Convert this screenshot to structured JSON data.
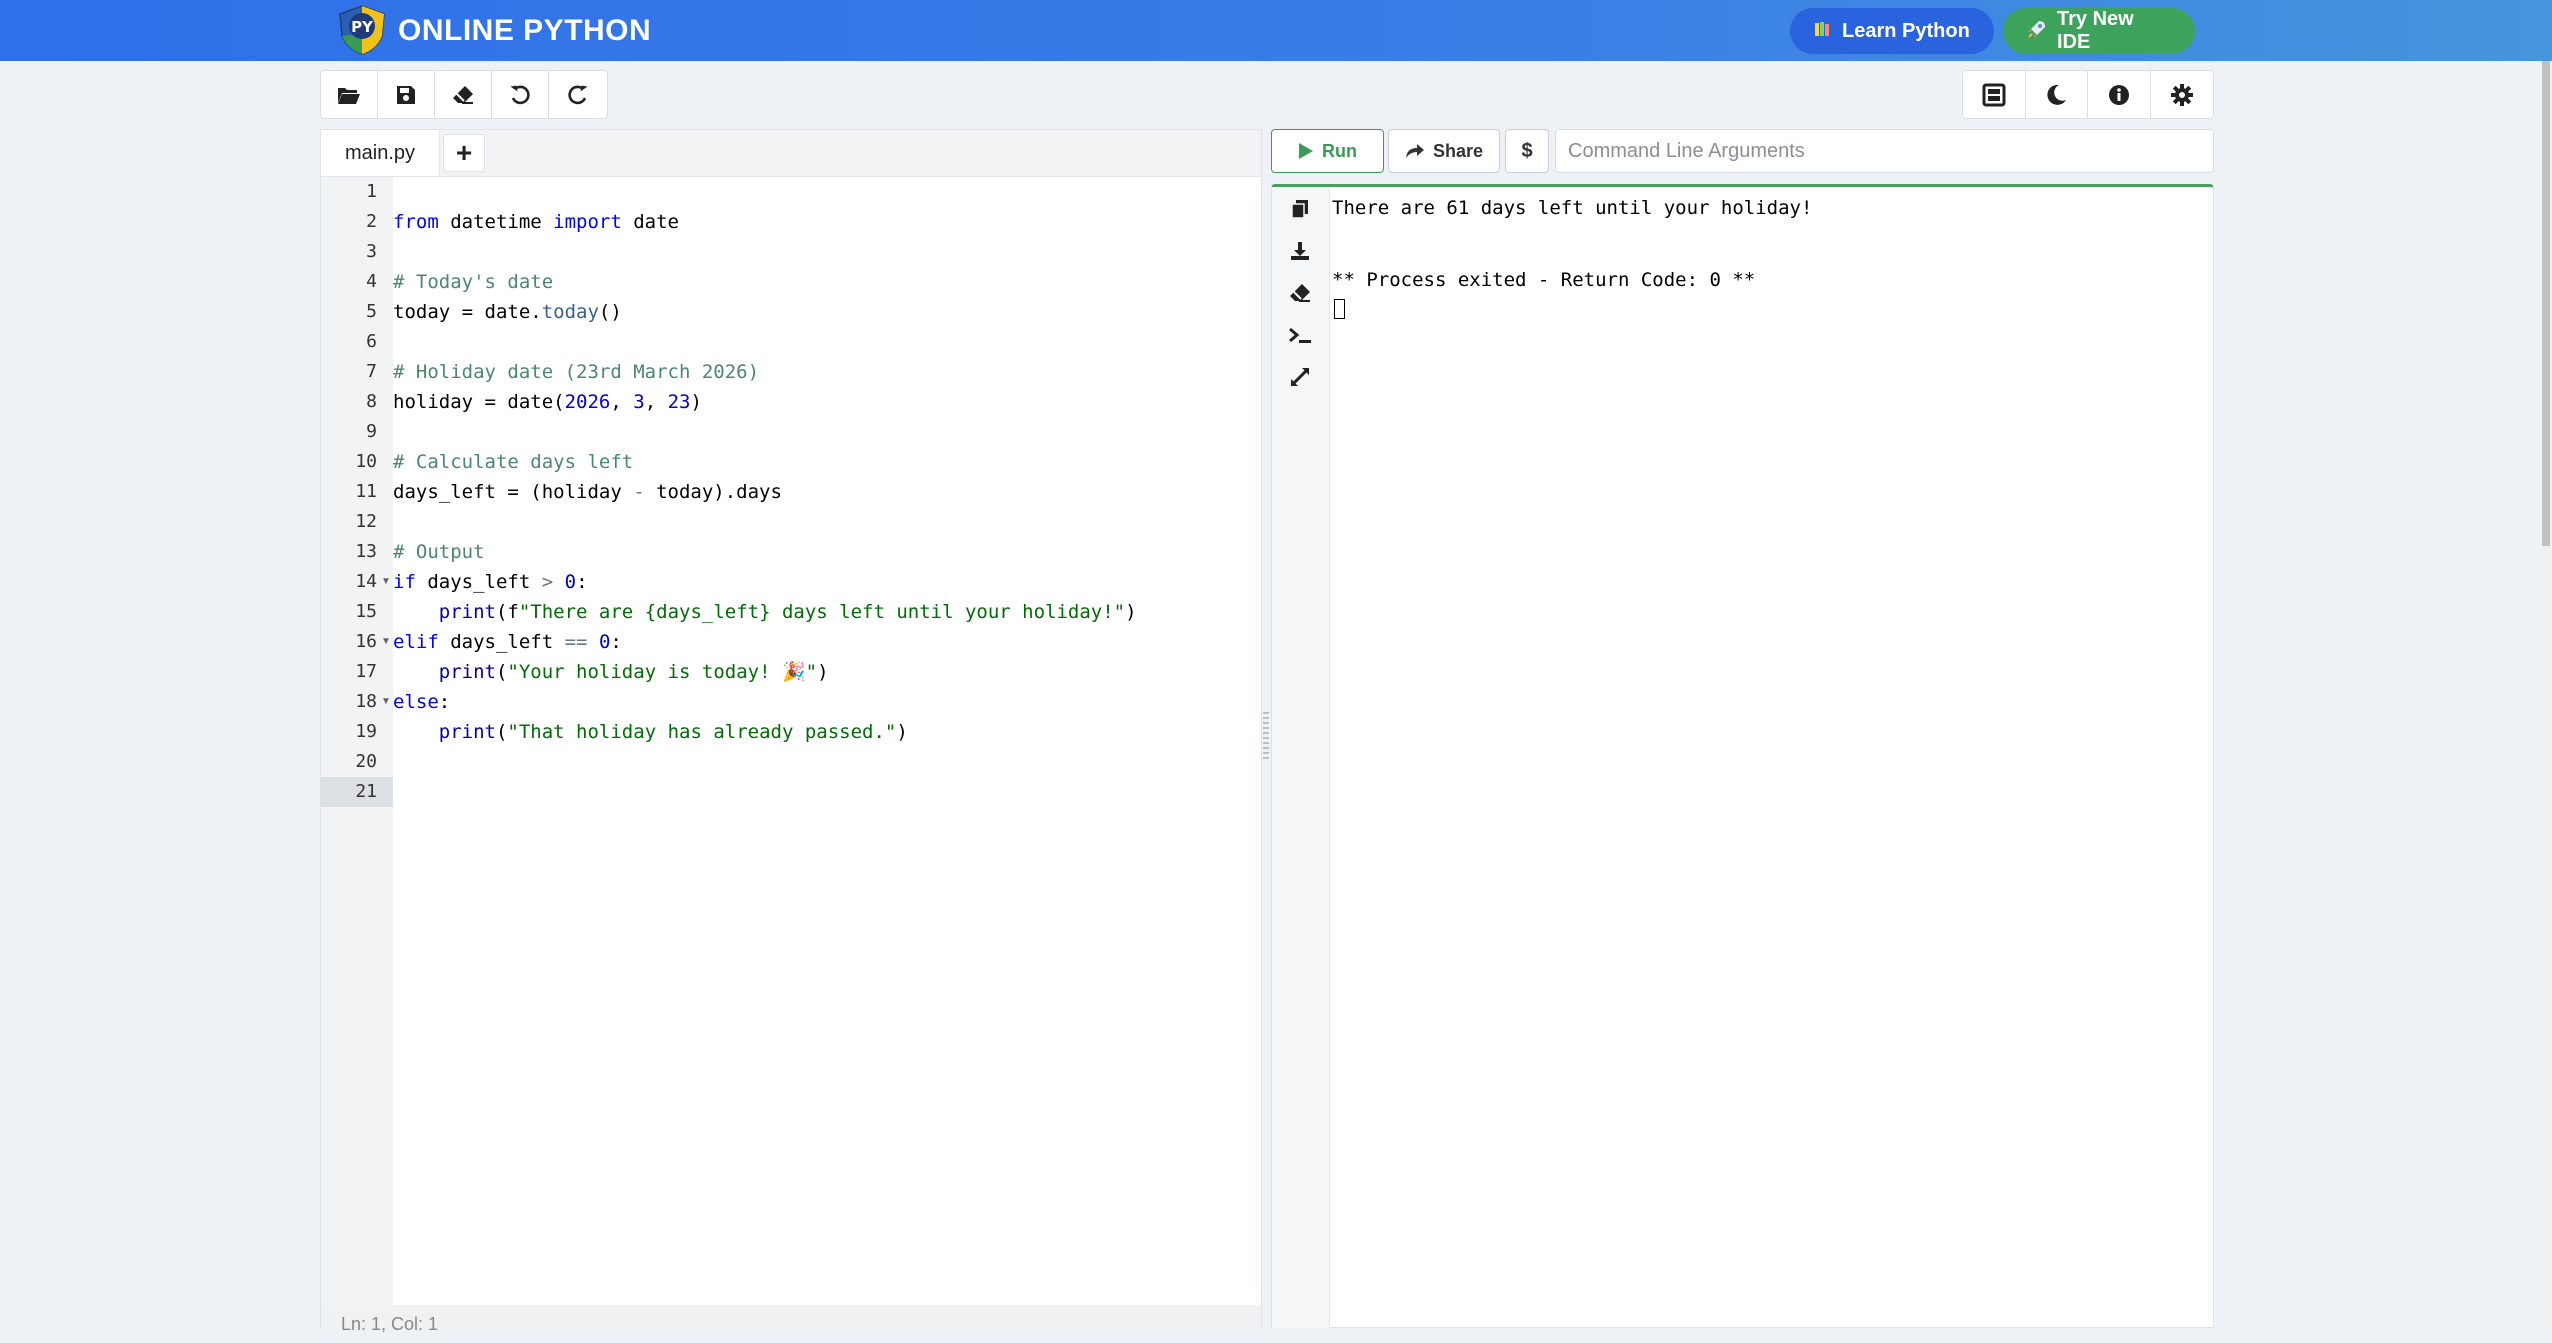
{
  "header": {
    "logo_text": "PY",
    "brand": "ONLINE PYTHON",
    "learn_label": "Learn Python",
    "try_ide_label": "Try New IDE",
    "brand_color": "#2f6fe8"
  },
  "toolbar_left": {
    "icons": [
      "folder-open-icon",
      "save-icon",
      "eraser-icon",
      "undo-icon",
      "redo-icon"
    ]
  },
  "toolbar_right": {
    "icons": [
      "layout-icon",
      "moon-icon",
      "info-icon",
      "gear-icon"
    ]
  },
  "editor": {
    "tab_label": "main.py",
    "add_tab_label": "+",
    "active_line": 21,
    "status": "Ln: 1,  Col: 1",
    "lines": [
      "",
      "from datetime import date",
      "",
      "# Today's date",
      "today = date.today()",
      "",
      "# Holiday date (23rd March 2026)",
      "holiday = date(2026, 3, 23)",
      "",
      "# Calculate days left",
      "days_left = (holiday - today).days",
      "",
      "# Output",
      "if days_left > 0:",
      "    print(f\"There are {days_left} days left until your holiday!\")",
      "elif days_left == 0:",
      "    print(\"Your holiday is today! 🎉\")",
      "else:",
      "    print(\"That holiday has already passed.\")",
      "",
      ""
    ],
    "line_numbers": [
      "1",
      "2",
      "3",
      "4",
      "5",
      "6",
      "7",
      "8",
      "9",
      "10",
      "11",
      "12",
      "13",
      "14",
      "15",
      "16",
      "17",
      "18",
      "19",
      "20",
      "21"
    ]
  },
  "run_bar": {
    "run_label": "Run",
    "share_label": "Share",
    "dollar_label": "$",
    "args_placeholder": "Command Line Arguments",
    "run_color": "#3a9b55"
  },
  "output": {
    "icons": [
      "copy-icon",
      "download-icon",
      "eraser-icon",
      "terminal-icon",
      "expand-icon"
    ],
    "lines": [
      "There are 61 days left until your holiday!",
      "",
      "** Process exited - Return Code: 0 **"
    ]
  }
}
